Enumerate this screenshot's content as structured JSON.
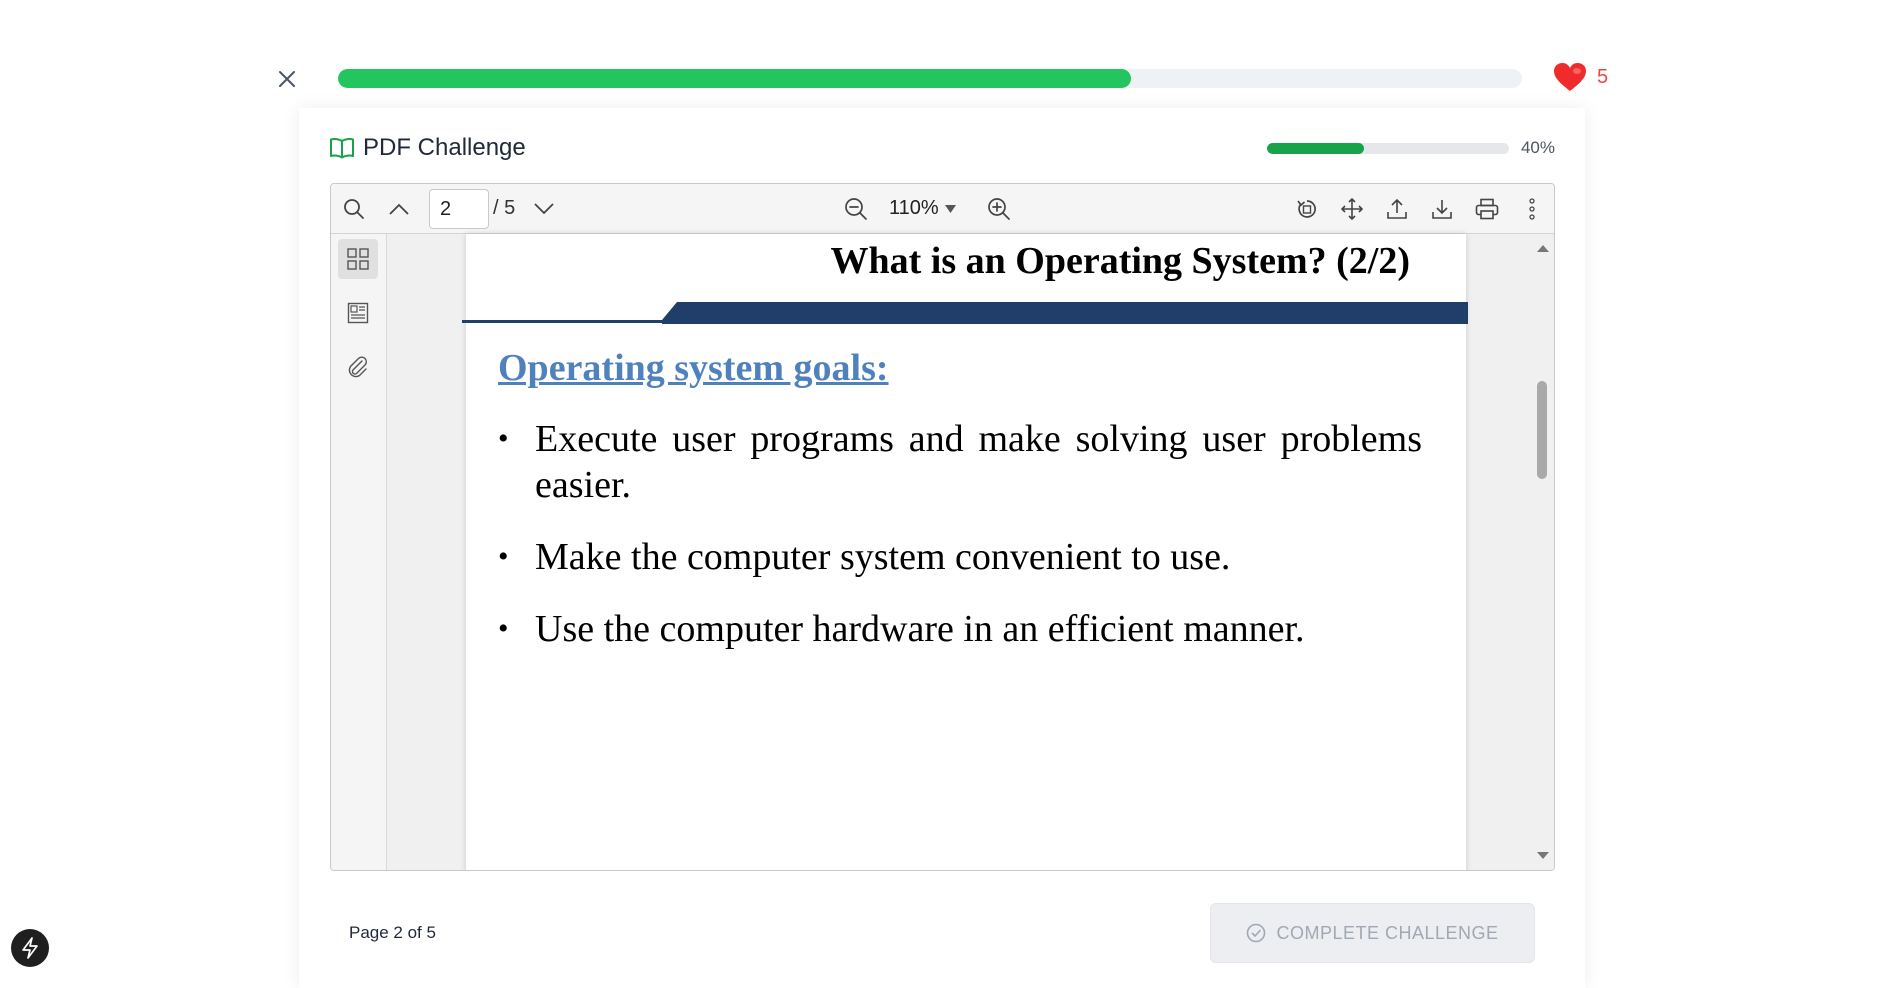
{
  "top_bar": {
    "lesson_progress_percent": 67,
    "hearts_count": "5",
    "colors": {
      "progress": "#22c55e",
      "heart": "#ef4444"
    }
  },
  "card": {
    "title": "PDF Challenge",
    "progress_percent": 40,
    "progress_label": "40%"
  },
  "viewer": {
    "toolbar": {
      "current_page": "2",
      "total_pages": "/ 5",
      "zoom": "110%"
    },
    "page": {
      "title": "What is an Operating System? (2/2)",
      "subtitle": "Operating system goals:",
      "bullets": [
        "Execute user programs and make solving user problems easier.",
        "Make the computer system convenient to use.",
        "Use the computer hardware in an efficient manner."
      ]
    }
  },
  "footer": {
    "page_status": "Page 2 of 5",
    "complete_button": "COMPLETE CHALLENGE"
  }
}
